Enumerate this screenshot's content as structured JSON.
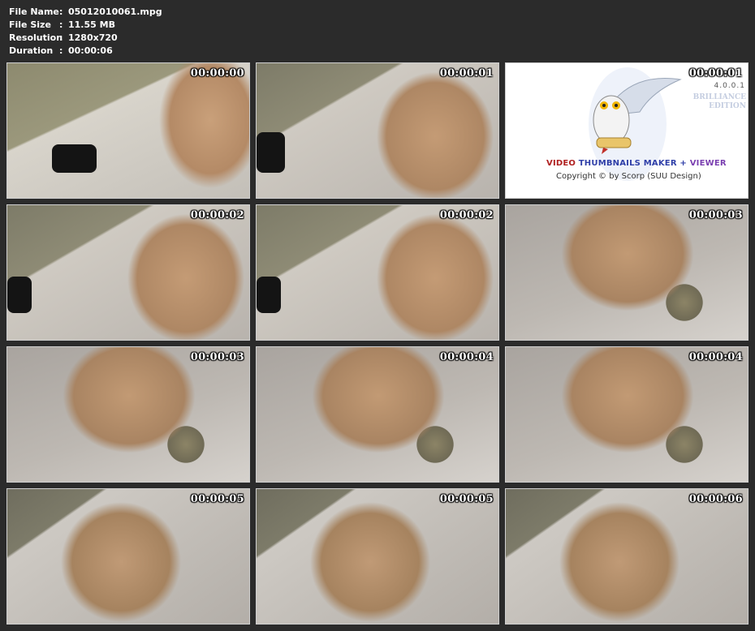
{
  "file_info": [
    {
      "label": "File Name",
      "value": "05012010061.mpg"
    },
    {
      "label": "File Size",
      "value": "11.55 MB"
    },
    {
      "label": "Resolution",
      "value": "1280x720"
    },
    {
      "label": "Duration",
      "value": "00:00:06"
    }
  ],
  "separator": ":",
  "thumbnails": [
    {
      "timestamp": "00:00:00"
    },
    {
      "timestamp": "00:00:01"
    },
    {
      "timestamp": "00:00:01"
    },
    {
      "timestamp": "00:00:02"
    },
    {
      "timestamp": "00:00:02"
    },
    {
      "timestamp": "00:00:03"
    },
    {
      "timestamp": "00:00:03"
    },
    {
      "timestamp": "00:00:04"
    },
    {
      "timestamp": "00:00:04"
    },
    {
      "timestamp": "00:00:05"
    },
    {
      "timestamp": "00:00:05"
    },
    {
      "timestamp": "00:00:06"
    }
  ],
  "logo": {
    "title_word1": "VIDEO",
    "title_word2": "THUMBNAILS MAKER",
    "title_plus": "+",
    "title_word3": "VIEWER",
    "copyright": "Copyright © by Scorp (SUU Design)",
    "version": "4.0.0.1",
    "edition_line1": "BRILLIANCE",
    "edition_line2": "EDITION",
    "icon": "owl-icon"
  }
}
